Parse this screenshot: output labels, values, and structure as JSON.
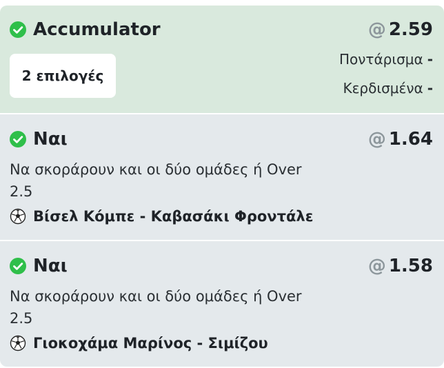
{
  "accumulator": {
    "title": "Accumulator",
    "odds_prefix": "@",
    "odds": "2.59",
    "selections_label": "2 επιλογές",
    "stake_label": "Ποντάρισμα",
    "stake_value": "-",
    "winnings_label": "Κερδισμένα",
    "winnings_value": "-"
  },
  "selections": [
    {
      "pick": "Ναι",
      "odds_prefix": "@",
      "odds": "1.64",
      "market": "Να σκοράρουν και οι δύο ομάδες ή Over 2.5",
      "match": "Βίσελ Κόμπε - Καβασάκι Φροντάλε",
      "sport_icon": "soccer-ball-icon"
    },
    {
      "pick": "Ναι",
      "odds_prefix": "@",
      "odds": "1.58",
      "market": "Να σκοράρουν και οι δύο ομάδες ή Over 2.5",
      "match": "Γιοκοχάμα Μαρίνος - Σιμίζου",
      "sport_icon": "soccer-ball-icon"
    }
  ],
  "colors": {
    "check_green": "#2fbf4a",
    "accumulator_bg": "#d9e9dd",
    "selection_bg": "#e4e9ec",
    "odds_at_gray": "#8c969b"
  }
}
